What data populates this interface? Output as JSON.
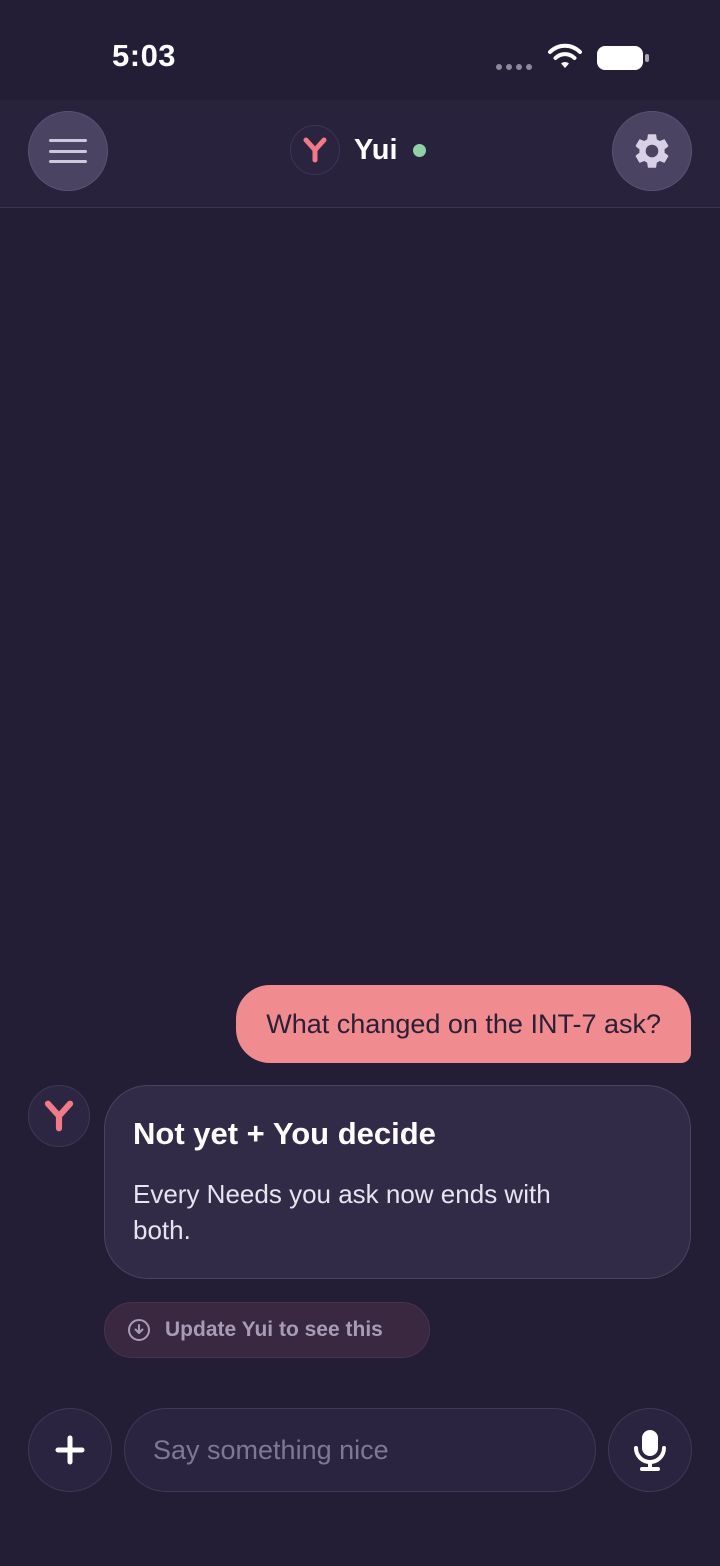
{
  "status_bar": {
    "time": "5:03"
  },
  "header": {
    "title": "Yui",
    "online": true,
    "accent_color": "#f07a86",
    "online_color": "#8fd0a8"
  },
  "messages": [
    {
      "role": "user",
      "text": "What changed on the INT-7 ask?"
    },
    {
      "role": "assistant",
      "title": "Not yet + You decide",
      "body": "Every Needs you ask now ends with both."
    }
  ],
  "update_notice": {
    "label": "Update Yui to see this",
    "icon": "download-circle-icon"
  },
  "composer": {
    "placeholder": "Say something nice",
    "value": ""
  }
}
